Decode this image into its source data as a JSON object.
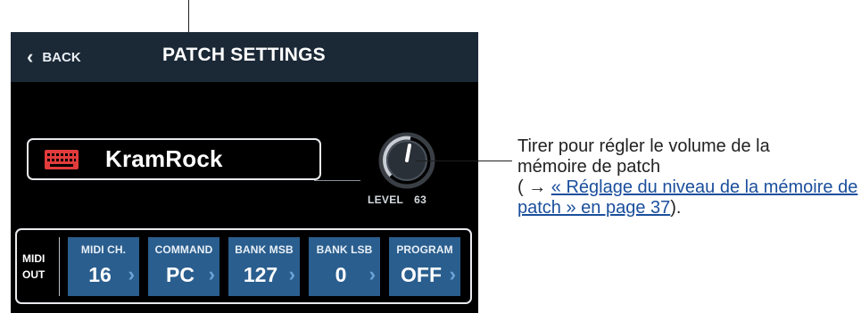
{
  "header": {
    "back_label": "BACK",
    "title": "PATCH SETTINGS"
  },
  "patch": {
    "name": "KramRock",
    "icon": "keyboard-icon"
  },
  "level": {
    "label": "LEVEL",
    "value": "63"
  },
  "midi": {
    "label_line1": "MIDI",
    "label_line2": "OUT",
    "params": [
      {
        "label": "MIDI CH.",
        "value": "16"
      },
      {
        "label": "COMMAND",
        "value": "PC"
      },
      {
        "label": "BANK MSB",
        "value": "127"
      },
      {
        "label": "BANK LSB",
        "value": "0"
      },
      {
        "label": "PROGRAM",
        "value": "OFF"
      }
    ]
  },
  "callout": {
    "text_line1": "Tirer pour régler le volume de la",
    "text_line2": "mémoire de patch",
    "ref_prefix": "( → ",
    "ref_link": "« Réglage du niveau de la mémoire de patch » en page 37",
    "ref_suffix": ")."
  },
  "colors": {
    "header_bg": "#1b2836",
    "param_bg": "#2a5e8e",
    "keyboard_icon": "#e23b3b",
    "link": "#1b4f9c"
  }
}
